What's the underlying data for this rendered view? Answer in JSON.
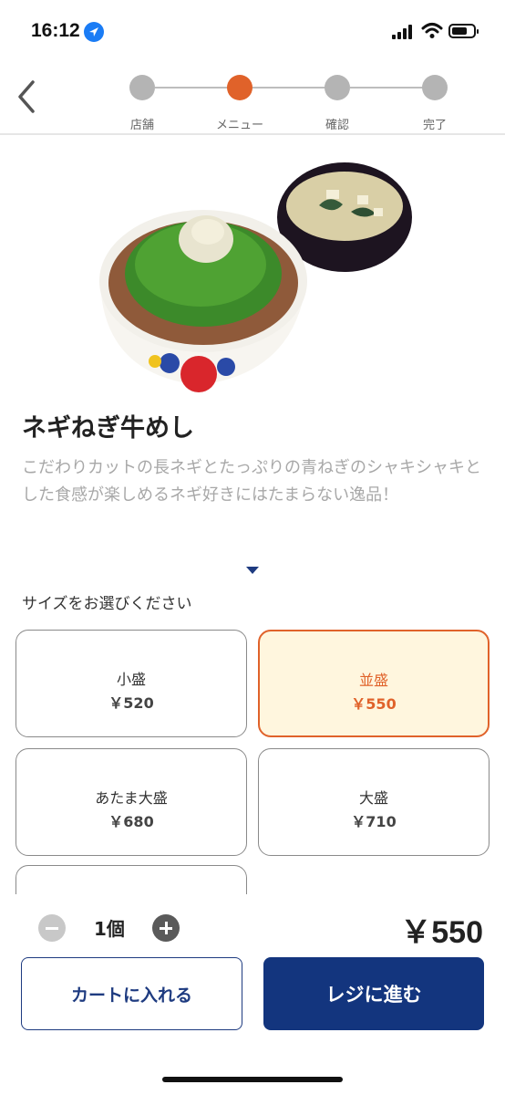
{
  "status_bar": {
    "time": "16:12"
  },
  "stepper": {
    "steps": [
      {
        "label": "店舗",
        "active": false
      },
      {
        "label": "メニュー",
        "active": true
      },
      {
        "label": "確認",
        "active": false
      },
      {
        "label": "完了",
        "active": false
      }
    ]
  },
  "product": {
    "name": "ネギねぎ牛めし",
    "description": "こだわりカットの長ネギとたっぷりの青ねぎのシャキシャキとした食感が楽しめるネギ好きにはたまらない逸品！"
  },
  "size_section": {
    "prompt": "サイズをお選びください",
    "options": [
      {
        "name": "小盛",
        "price": "￥520",
        "selected": false
      },
      {
        "name": "並盛",
        "price": "￥550",
        "selected": true
      },
      {
        "name": "あたま大盛",
        "price": "￥680",
        "selected": false
      },
      {
        "name": "大盛",
        "price": "￥710",
        "selected": false
      },
      {
        "name": "",
        "price": "",
        "selected": false
      }
    ]
  },
  "order": {
    "quantity": "1個",
    "total": "￥550",
    "cart_label": "カートに入れる",
    "checkout_label": "レジに進む"
  },
  "colors": {
    "accent": "#e0622a",
    "primary": "#13357e",
    "selected_bg": "#fff6de"
  },
  "icons": [
    "location-arrow-icon",
    "signal-icon",
    "wifi-icon",
    "battery-icon",
    "back-chevron-icon",
    "expand-triangle-icon",
    "minus-icon",
    "plus-icon"
  ]
}
